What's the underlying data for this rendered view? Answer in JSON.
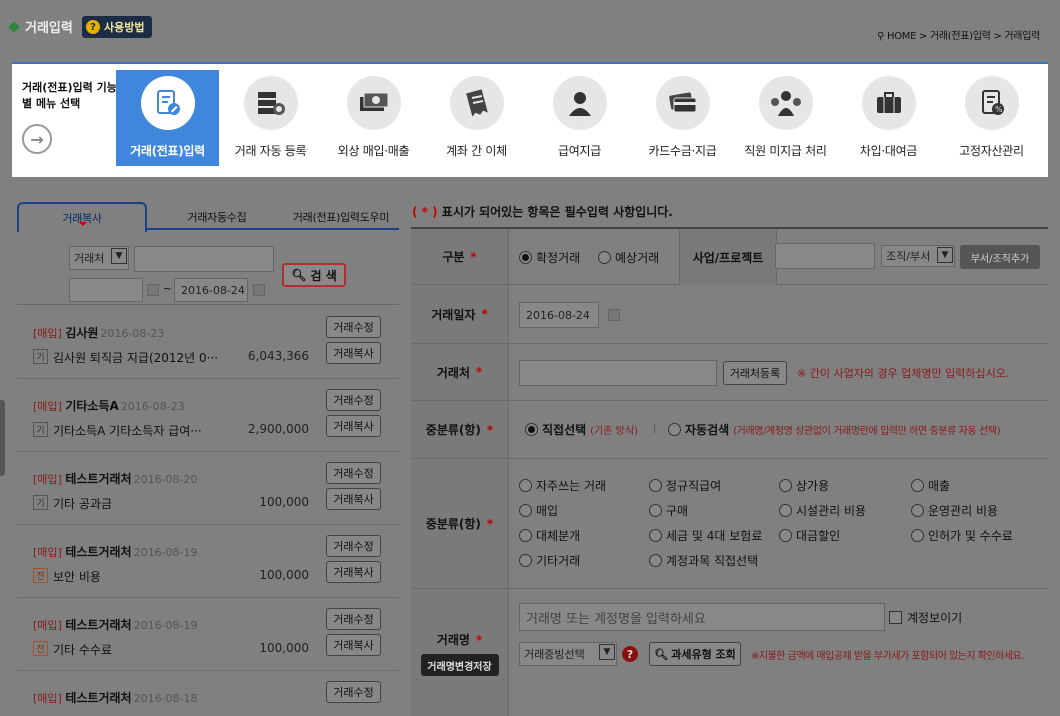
{
  "header": {
    "title": "거래입력",
    "help_label": "사용방법",
    "breadcrumb": "HOME > 거래(전표)입력 > 거래입력"
  },
  "menubar": {
    "intro": "거래(전표)입력 기능별 메뉴 선택",
    "items": [
      {
        "label": "거래(전표)입력",
        "icon": "document-edit-icon",
        "active": true
      },
      {
        "label": "거래 자동 등록",
        "icon": "server-sync-icon"
      },
      {
        "label": "외상 매입·매출",
        "icon": "money-bill-icon"
      },
      {
        "label": "계좌 간 이체",
        "icon": "receipt-icon"
      },
      {
        "label": "급여지급",
        "icon": "person-icon"
      },
      {
        "label": "카드수금·지급",
        "icon": "credit-card-icon"
      },
      {
        "label": "직원 미지급 처리",
        "icon": "employee-payment-icon"
      },
      {
        "label": "차입·대여금",
        "icon": "briefcase-icon"
      },
      {
        "label": "고정자산관리",
        "icon": "asset-document-icon"
      }
    ]
  },
  "left": {
    "tabs": [
      "거래복사",
      "거래자동수집",
      "거래(전표)입력도우미"
    ],
    "search": {
      "type": "거래처",
      "keyword": "",
      "date_from": "",
      "date_to": "2016-08-24",
      "button": "검 색",
      "tilde": "~"
    },
    "rows": [
      {
        "cat": "[매입]",
        "name": "김사원",
        "date": "2016-08-23",
        "badge": "기",
        "desc": "김사원 퇴직금 지급(2012년 0···",
        "amount": "6,043,366",
        "edit": "거래수정",
        "copy": "거래복사"
      },
      {
        "cat": "[매입]",
        "name": "기타소득A",
        "date": "2016-08-23",
        "badge": "기",
        "desc": "기타소득A 기타소득자 급여···",
        "amount": "2,900,000",
        "edit": "거래수정",
        "copy": "거래복사"
      },
      {
        "cat": "[매입]",
        "name": "테스트거래처",
        "date": "2016-08-20",
        "badge": "기",
        "desc": "기타 공과금",
        "amount": "100,000",
        "edit": "거래수정",
        "copy": "거래복사"
      },
      {
        "cat": "[매입]",
        "name": "테스트거래처",
        "date": "2016-08-19",
        "badge": "전",
        "desc": "보안 비용",
        "amount": "100,000",
        "edit": "거래수정",
        "copy": "거래복사"
      },
      {
        "cat": "[매입]",
        "name": "테스트거래처",
        "date": "2016-08-19",
        "badge": "전",
        "desc": "기타 수수료",
        "amount": "100,000",
        "edit": "거래수정",
        "copy": "거래복사"
      },
      {
        "cat": "[매입]",
        "name": "테스트거래처",
        "date": "2016-08-18",
        "badge": "",
        "desc": "",
        "amount": "",
        "edit": "거래수정",
        "copy": ""
      }
    ]
  },
  "form": {
    "notice_mark": "( * )",
    "notice_text": "표시가 되어있는 항목은 필수입력 사항입니다.",
    "star": "*",
    "gubun": {
      "label": "구분",
      "opt1": "확정거래",
      "opt2": "예상거래",
      "project_label": "사업/프로젝트",
      "org_select": "조직/부서",
      "org_btn": "부서/조직추가"
    },
    "date": {
      "label": "거래일자",
      "value": "2016-08-24"
    },
    "partner": {
      "label": "거래처",
      "btn": "거래처등록",
      "hint": "※ 간이 사업자의 경우 업체명만 입력하십시오."
    },
    "mid1": {
      "label": "중분류(항)",
      "opt1": "직접선택",
      "opt1_note": "(기존 방식)",
      "sep": "|",
      "opt2": "자동검색",
      "opt2_note": "(거래명/계정명 상관없이 거래명란에 입력만 하면 중분류 자동 선택)"
    },
    "mid2": {
      "label": "중분류(항)",
      "options": [
        "자주쓰는 거래",
        "정규직급여",
        "상가용",
        "매출",
        "매입",
        "구매",
        "시설관리 비용",
        "운영관리 비용",
        "대체분개",
        "세금 및 4대 보험료",
        "대금할인",
        "인허가 및 수수료",
        "기타거래",
        "계정과목 직접선택"
      ]
    },
    "tname": {
      "label": "거래명",
      "save_btn": "거래명변경저장",
      "placeholder": "거래명 또는 계정명을 입력하세요",
      "show_account": "계정보이기",
      "evidence": "거래증빙선택",
      "tax_btn": "과세유형 조회",
      "warn": "※지불한 금액에 매입공제 받을 부가세가 포함되어 있는지 확인하세요."
    }
  }
}
